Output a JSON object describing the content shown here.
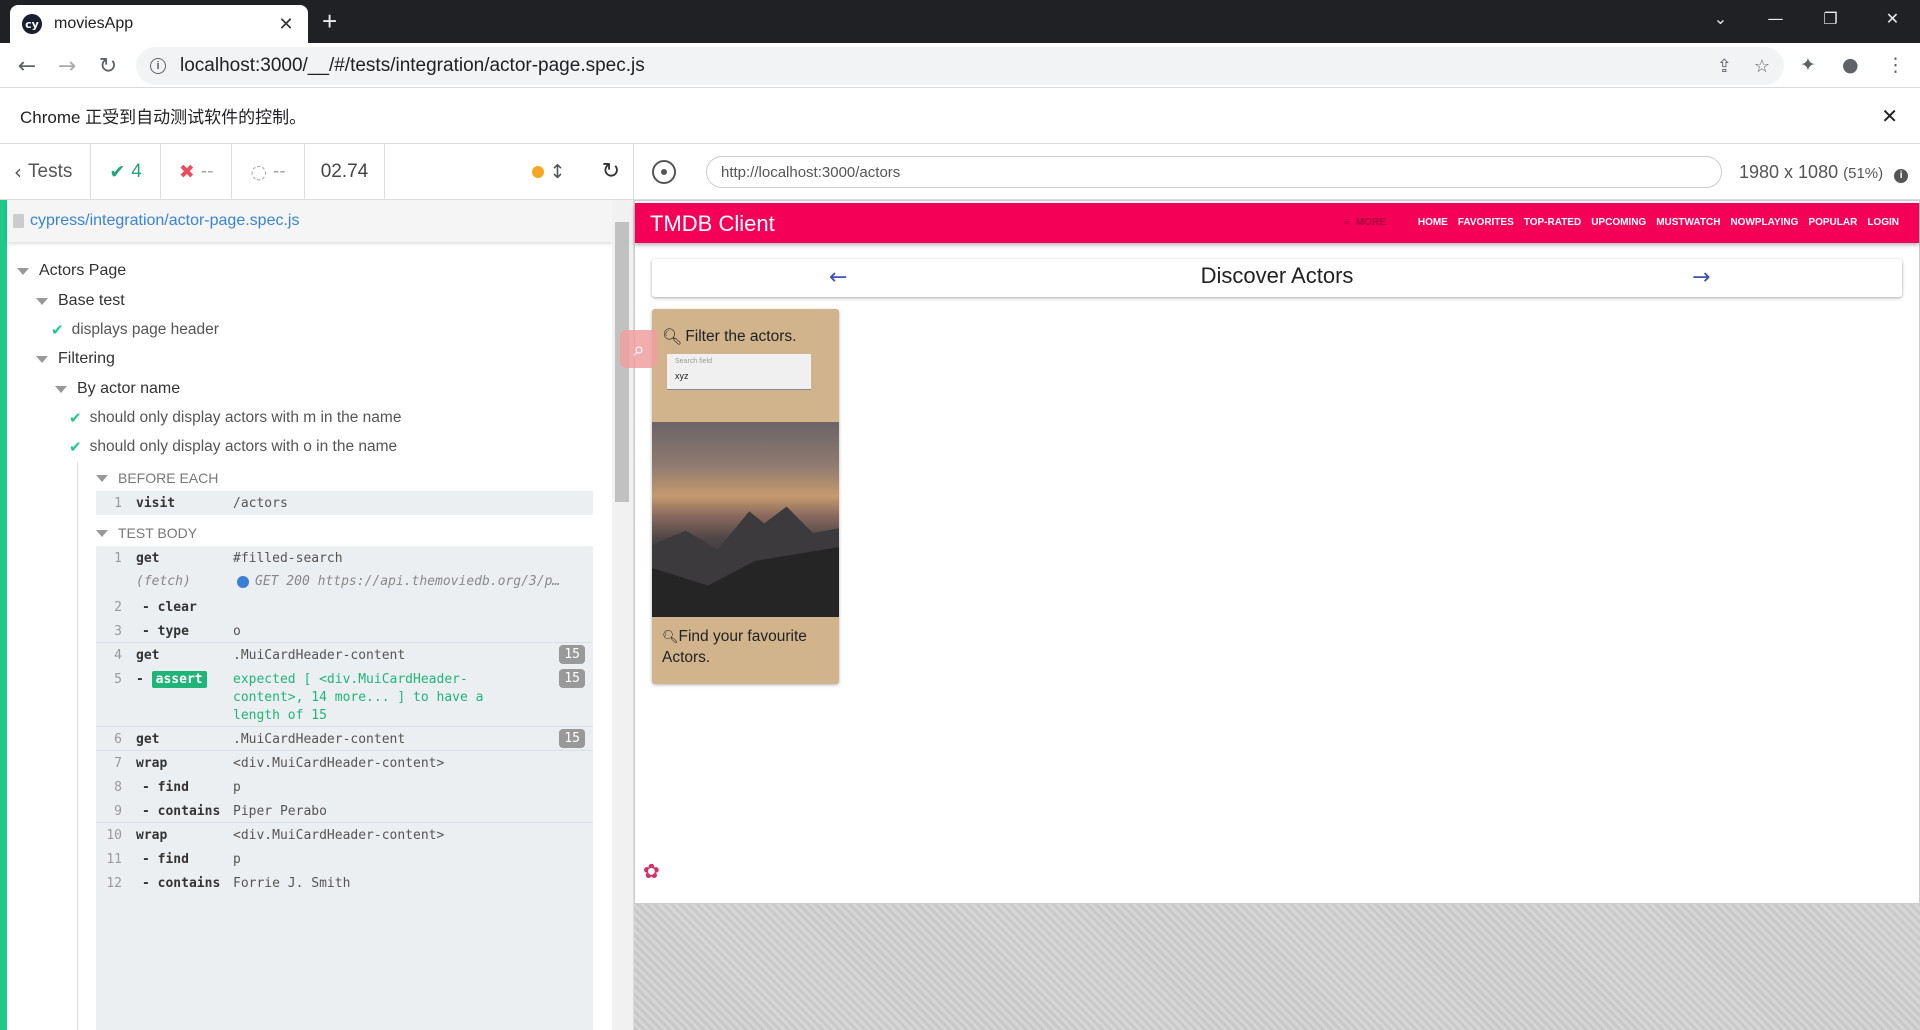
{
  "browser": {
    "tab_title": "moviesApp",
    "tab_favicon": "cy",
    "url": "localhost:3000/__/#/tests/integration/actor-page.spec.js",
    "infobar_text": "Chrome 正受到自动测试软件的控制。"
  },
  "reporter": {
    "back_label": "Tests",
    "passed": "4",
    "failed": "--",
    "pending": "--",
    "duration": "02.74",
    "spec_path": "cypress/integration/actor-page.spec.js",
    "suites": {
      "root": "Actors Page",
      "base": "Base test",
      "base_test": "displays page header",
      "filtering": "Filtering",
      "by_name": "By actor name",
      "test_m": "should only display actors with m in the name",
      "test_o": "should only display actors with o in the name"
    },
    "before_each_label": "BEFORE EACH",
    "test_body_label": "TEST BODY",
    "before_each": [
      {
        "num": "1",
        "name": "visit",
        "msg": "/actors"
      }
    ],
    "commands": [
      {
        "num": "1",
        "name": "get",
        "msg": "#filled-search",
        "badge": ""
      },
      {
        "num": "",
        "name": "(fetch)",
        "msg": "GET 200 https://api.themoviedb.org/3/p…",
        "badge": ""
      },
      {
        "num": "2",
        "name": "- clear",
        "msg": "",
        "badge": ""
      },
      {
        "num": "3",
        "name": "- type",
        "msg": "o",
        "badge": ""
      },
      {
        "num": "4",
        "name": "get",
        "msg": ".MuiCardHeader-content",
        "badge": "15"
      },
      {
        "num": "5",
        "name": "- assert",
        "msg": "expected [ <div.MuiCardHeader-",
        "badge": "15"
      },
      {
        "num": "",
        "name": "",
        "msg": "content>, 14 more... ] to have a",
        "badge": ""
      },
      {
        "num": "",
        "name": "",
        "msg": "length of 15",
        "badge": ""
      },
      {
        "num": "6",
        "name": "get",
        "msg": ".MuiCardHeader-content",
        "badge": "15"
      },
      {
        "num": "7",
        "name": "wrap",
        "msg": "<div.MuiCardHeader-content>",
        "badge": ""
      },
      {
        "num": "8",
        "name": "- find",
        "msg": "p",
        "badge": ""
      },
      {
        "num": "9",
        "name": "- contains",
        "msg": "Piper Perabo",
        "badge": ""
      },
      {
        "num": "10",
        "name": "wrap",
        "msg": "<div.MuiCardHeader-content>",
        "badge": ""
      },
      {
        "num": "11",
        "name": "- find",
        "msg": "p",
        "badge": ""
      },
      {
        "num": "12",
        "name": "- contains",
        "msg": "Forrie J. Smith",
        "badge": ""
      }
    ]
  },
  "aut": {
    "url": "http://localhost:3000/actors",
    "size": "1980 x 1080",
    "scale": "(51%)",
    "app_title": "TMDB Client",
    "nav_more": "MORE",
    "nav": [
      "HOME",
      "FAVORITES",
      "TOP-RATED",
      "UPCOMING",
      "MUSTWATCH",
      "NOWPLAYING",
      "POPULAR",
      "LOGIN"
    ],
    "discover_title": "Discover Actors",
    "filter_label": "Filter the actors.",
    "search_label": "Search field",
    "search_value": "xyz",
    "card_footer": "Find your favourite Actors."
  },
  "colors": {
    "app_bar": "#f50057",
    "card": "#d2b48c",
    "pass": "#1fc98a",
    "fail": "#e94f5f"
  }
}
